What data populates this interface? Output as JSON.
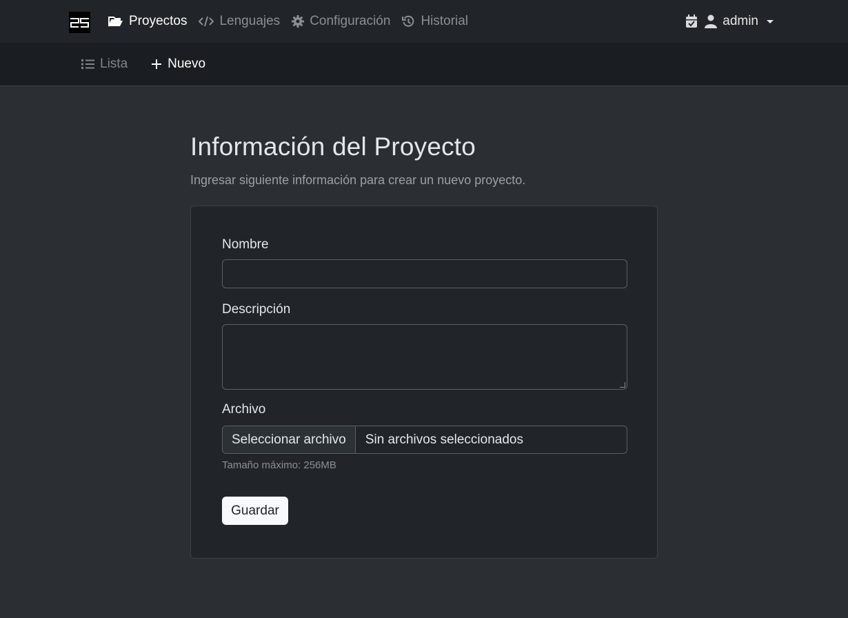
{
  "brand": {
    "logo_text": "ZS"
  },
  "topnav": {
    "items": [
      {
        "label": "Proyectos",
        "icon": "folder-open-icon",
        "active": true
      },
      {
        "label": "Lenguajes",
        "icon": "code-icon",
        "active": false
      },
      {
        "label": "Configuración",
        "icon": "gear-icon",
        "active": false
      },
      {
        "label": "Historial",
        "icon": "history-icon",
        "active": false
      }
    ],
    "user": {
      "name": "admin"
    }
  },
  "subnav": {
    "items": [
      {
        "label": "Lista",
        "icon": "list-icon",
        "active": false
      },
      {
        "label": "Nuevo",
        "icon": "plus-icon",
        "active": true
      }
    ]
  },
  "page": {
    "title": "Información del Proyecto",
    "subtitle": "Ingresar siguiente información para crear un nuevo proyecto."
  },
  "form": {
    "name_label": "Nombre",
    "name_value": "",
    "description_label": "Descripción",
    "description_value": "",
    "file_label": "Archivo",
    "file_button": "Seleccionar archivo",
    "file_status": "Sin archivos seleccionados",
    "file_help": "Tamaño máximo: 256MB",
    "submit_label": "Guardar"
  }
}
